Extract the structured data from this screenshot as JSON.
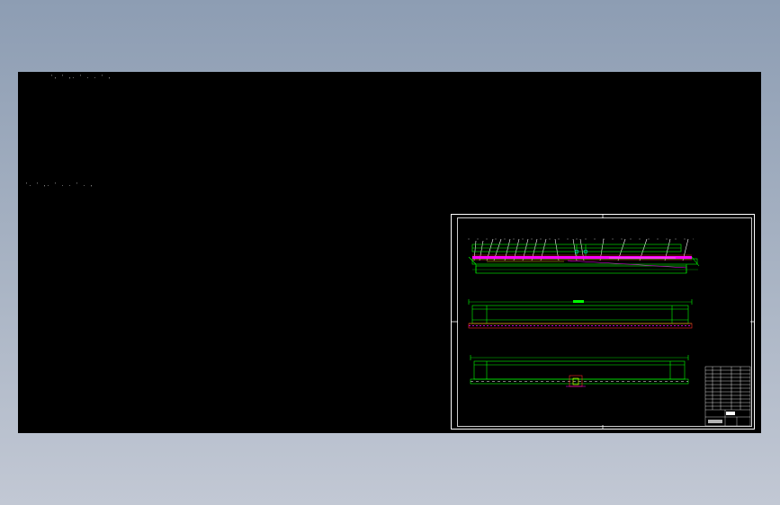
{
  "canvas": {
    "background": "#000000",
    "frame_color": "#ffffff",
    "line_colors": {
      "green": "#00ff00",
      "red": "#ff2a2a",
      "magenta": "#ff00ff",
      "yellow": "#ffff00",
      "cyan": "#00ffff",
      "white": "#ffffff"
    }
  },
  "notes": {
    "line1": "',  '  ,.   '   . .  '    ,",
    "line2": "'.  '  ,.  '   .   .   '  .  ,"
  },
  "drawing_sheet": {
    "kind": "cad-drawing-sheet",
    "views": [
      "side-view",
      "top-view",
      "bottom-view"
    ],
    "has_title_block": true
  }
}
